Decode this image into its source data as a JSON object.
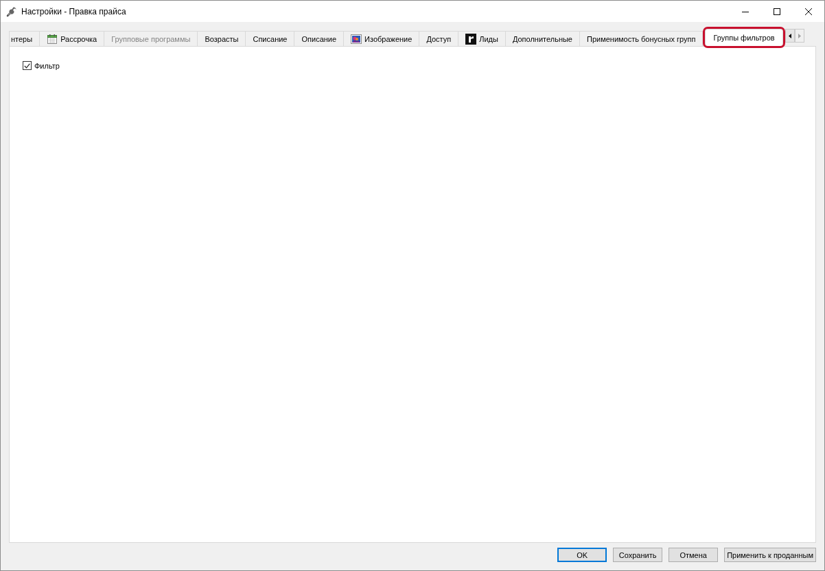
{
  "window": {
    "title": "Настройки - Правка прайса"
  },
  "tabs": [
    {
      "label": "нтеры",
      "kind": "text",
      "selected": false,
      "disabled": false,
      "highlighted": false
    },
    {
      "label": "Рассрочка",
      "kind": "calendar",
      "selected": false,
      "disabled": false,
      "highlighted": false
    },
    {
      "label": "Групповые программы",
      "kind": "text",
      "selected": false,
      "disabled": true,
      "highlighted": false
    },
    {
      "label": "Возрасты",
      "kind": "text",
      "selected": false,
      "disabled": false,
      "highlighted": false
    },
    {
      "label": "Списание",
      "kind": "text",
      "selected": false,
      "disabled": false,
      "highlighted": false
    },
    {
      "label": "Описание",
      "kind": "text",
      "selected": false,
      "disabled": false,
      "highlighted": false
    },
    {
      "label": "Изображение",
      "kind": "picture",
      "selected": false,
      "disabled": false,
      "highlighted": false
    },
    {
      "label": "Доступ",
      "kind": "text",
      "selected": false,
      "disabled": false,
      "highlighted": false
    },
    {
      "label": "Лиды",
      "kind": "letter",
      "selected": false,
      "disabled": false,
      "highlighted": false
    },
    {
      "label": "Дополнительные",
      "kind": "text",
      "selected": false,
      "disabled": false,
      "highlighted": false
    },
    {
      "label": "Применимость бонусных групп",
      "kind": "text",
      "selected": false,
      "disabled": false,
      "highlighted": false
    },
    {
      "label": "Группы фильтров",
      "kind": "text",
      "selected": true,
      "disabled": false,
      "highlighted": true
    }
  ],
  "tab_scroll": {
    "back_disabled": false,
    "forward_disabled": true
  },
  "panel": {
    "checkboxes": [
      {
        "label": "Фильтр",
        "checked": true
      }
    ]
  },
  "buttons": [
    {
      "label": "OK",
      "default": true
    },
    {
      "label": "Сохранить",
      "default": false
    },
    {
      "label": "Отмена",
      "default": false
    },
    {
      "label": "Применить к проданным",
      "default": false
    }
  ]
}
